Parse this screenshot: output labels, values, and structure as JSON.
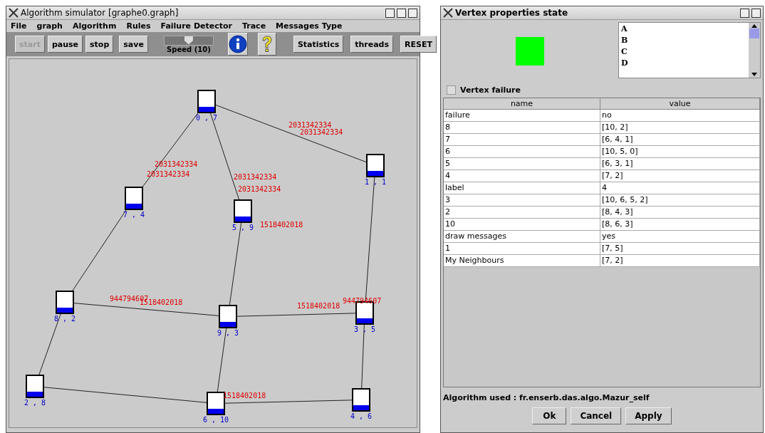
{
  "main_window": {
    "title": "Algorithm simulator [graphe0.graph]",
    "menu": [
      "File",
      "graph",
      "Algorithm",
      "Rules",
      "Failure Detector",
      "Trace",
      "Messages Type"
    ],
    "run_buttons": [
      {
        "label": "start",
        "disabled": true
      },
      {
        "label": "pause",
        "disabled": false
      },
      {
        "label": "stop",
        "disabled": false
      }
    ],
    "save_button": "save",
    "speed": {
      "label": "Speed (10)",
      "level": 0.5
    },
    "right_buttons": [
      "Statistics",
      "threads",
      "RESET"
    ],
    "graph": {
      "nodes": [
        {
          "label": "0 , 7"
        },
        {
          "label": "7 , 4"
        },
        {
          "label": "5 , 9"
        },
        {
          "label": "1 , 1"
        },
        {
          "label": "8 , 2"
        },
        {
          "label": "9 , 3"
        },
        {
          "label": "3 , 5"
        },
        {
          "label": "2 , 8"
        },
        {
          "label": "6 , 10"
        },
        {
          "label": "4 , 6"
        }
      ],
      "messages": [
        {
          "text": "2031342334"
        },
        {
          "text": "2031342334"
        },
        {
          "text": "2031342334"
        },
        {
          "text": "2031342334"
        },
        {
          "text": "2031342334"
        },
        {
          "text": "2031342334"
        },
        {
          "text": "1518402018"
        },
        {
          "text": "944794607"
        },
        {
          "text": "1518402018"
        },
        {
          "text": "1518402018"
        },
        {
          "text": "944794607"
        },
        {
          "text": "1518402018"
        }
      ]
    }
  },
  "properties_window": {
    "title": "Vertex properties state",
    "swatch": {
      "color": "#00ff00"
    },
    "list": [
      "A",
      "B",
      "C",
      "D"
    ],
    "vertex_failure": {
      "label": "Vertex failure",
      "checked": false
    },
    "table": {
      "columns": [
        "name",
        "value"
      ],
      "rows": [
        [
          "failure",
          "no"
        ],
        [
          "8",
          "[10, 2]"
        ],
        [
          "7",
          "[6, 4, 1]"
        ],
        [
          "6",
          "[10, 5, 0]"
        ],
        [
          "5",
          "[6, 3, 1]"
        ],
        [
          "4",
          "[7, 2]"
        ],
        [
          "label",
          "4"
        ],
        [
          "3",
          "[10, 6, 5, 2]"
        ],
        [
          "2",
          "[8, 4, 3]"
        ],
        [
          "10",
          "[8, 6, 3]"
        ],
        [
          "draw messages",
          "yes"
        ],
        [
          "1",
          "[7, 5]"
        ],
        [
          "My Neighbours",
          "[7, 2]"
        ]
      ]
    },
    "algorithm_used": "Algorithm used : fr.enserb.das.algo.Mazur_self",
    "buttons": [
      "Ok",
      "Cancel",
      "Apply"
    ]
  }
}
